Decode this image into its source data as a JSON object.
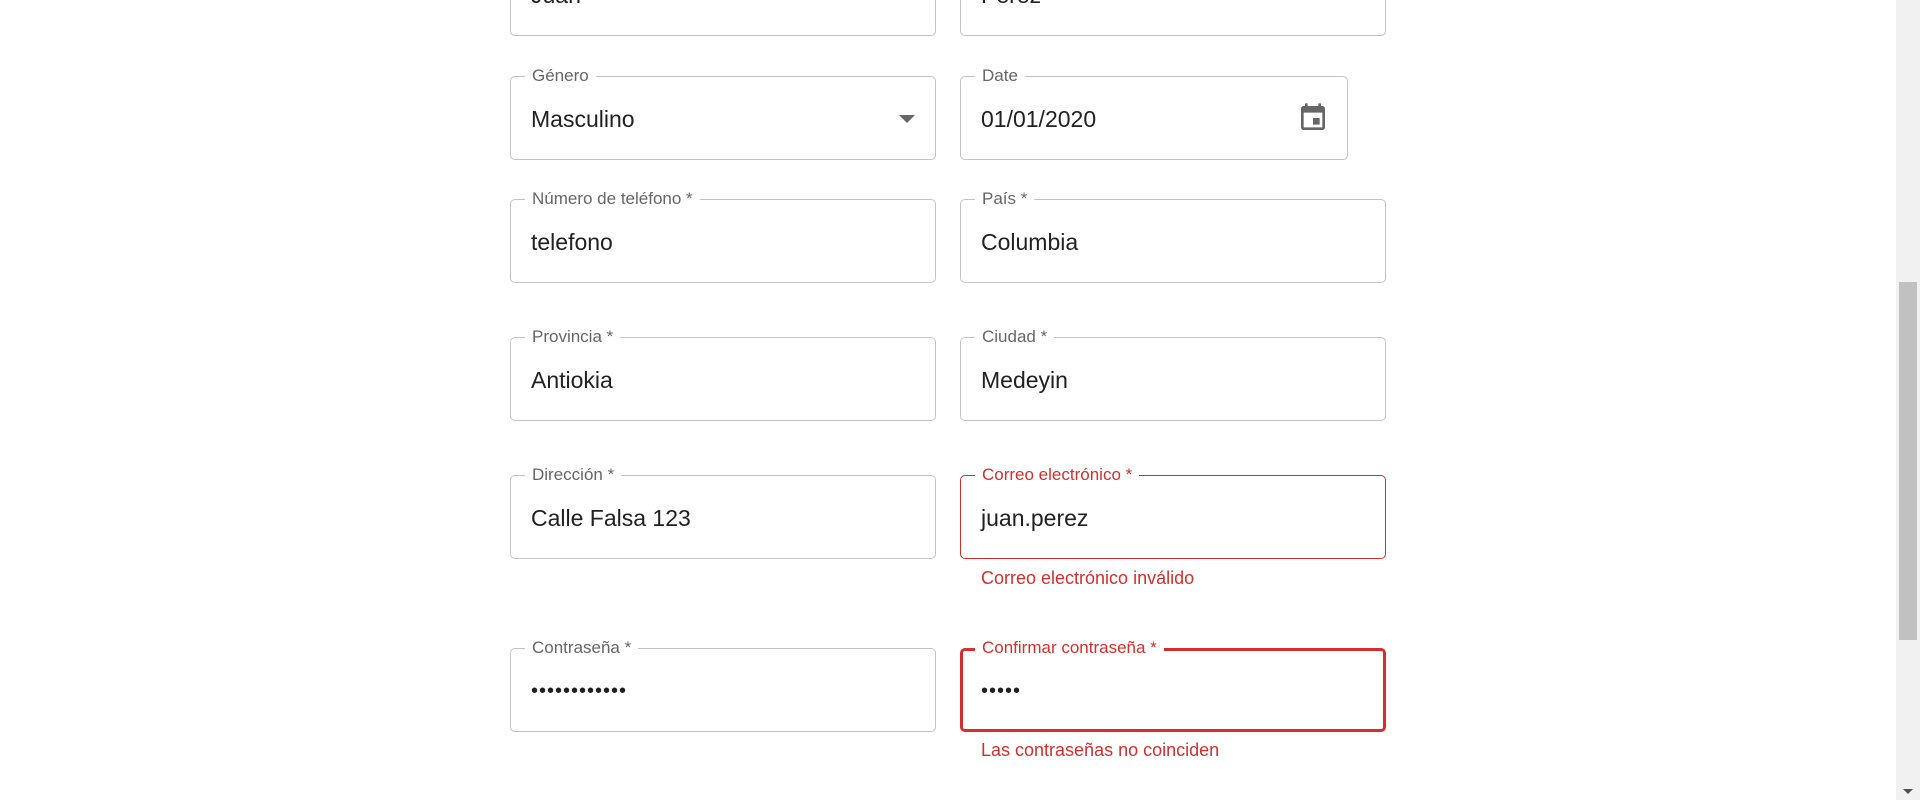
{
  "form": {
    "nombre": {
      "value": "Juan"
    },
    "apellido": {
      "value": "Perez"
    },
    "genero": {
      "label": "Género",
      "value": "Masculino"
    },
    "fecha": {
      "label": "Date",
      "value": "01/01/2020",
      "icon": "calendar-icon"
    },
    "telefono": {
      "label": "Número de teléfono *",
      "value": "telefono"
    },
    "pais": {
      "label": "País *",
      "value": "Columbia"
    },
    "provincia": {
      "label": "Provincia *",
      "value": "Antiokia"
    },
    "ciudad": {
      "label": "Ciudad *",
      "value": "Medeyin"
    },
    "direccion": {
      "label": "Dirección *",
      "value": "Calle Falsa 123"
    },
    "correo": {
      "label": "Correo electrónico *",
      "value": "juan.perez",
      "error": "Correo electrónico inválido"
    },
    "contrasena": {
      "label": "Contraseña *",
      "value": "••••••••••••"
    },
    "confirmar": {
      "label": "Confirmar contraseña *",
      "value": "•••••",
      "error": "Las contraseñas no coinciden"
    }
  },
  "colors": {
    "error": "#d32f2f",
    "border": "#c4c4c4",
    "label": "#666666",
    "text": "#212121"
  }
}
